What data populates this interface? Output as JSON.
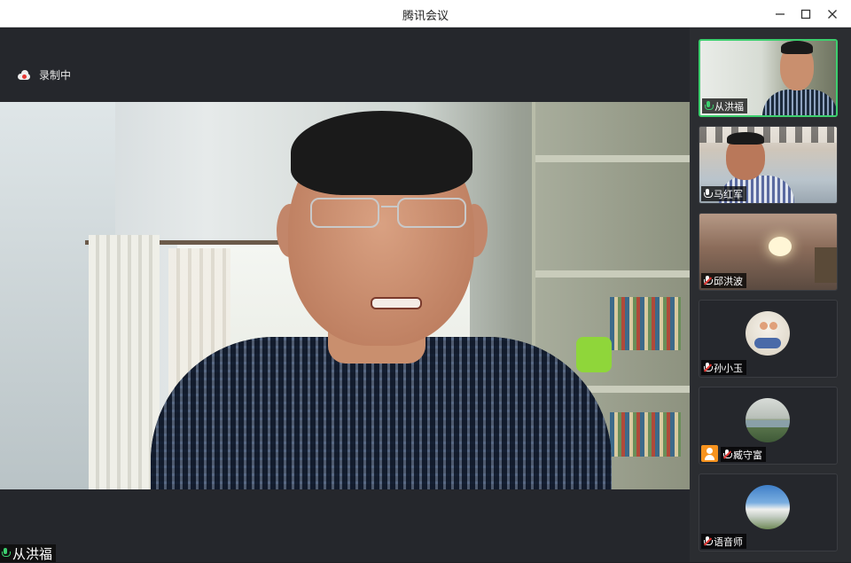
{
  "window": {
    "title": "腾讯会议",
    "minimize_icon": "minimize-icon",
    "maximize_icon": "maximize-icon",
    "close_icon": "close-icon"
  },
  "recording": {
    "label": "录制中",
    "icon": "cloud-record-icon",
    "dot_color": "#e53935"
  },
  "main_speaker": {
    "name": "从洪福",
    "mic_state": "speaking"
  },
  "participants": [
    {
      "name": "从洪福",
      "mic_state": "speaking",
      "video": true,
      "active": true
    },
    {
      "name": "马红军",
      "mic_state": "unmuted",
      "video": true,
      "active": false
    },
    {
      "name": "邱洪波",
      "mic_state": "muted",
      "video": true,
      "active": false
    },
    {
      "name": "孙小玉",
      "mic_state": "muted",
      "video": false,
      "active": false
    },
    {
      "name": "臧守富",
      "mic_state": "muted",
      "video": false,
      "active": false,
      "phone_user": true
    },
    {
      "name": "语音师",
      "mic_state": "muted",
      "video": false,
      "active": false
    }
  ],
  "colors": {
    "active_border": "#3ccf6e",
    "muted_slash": "#e53935",
    "background": "#25272c",
    "sidebar": "#2b2d31"
  }
}
